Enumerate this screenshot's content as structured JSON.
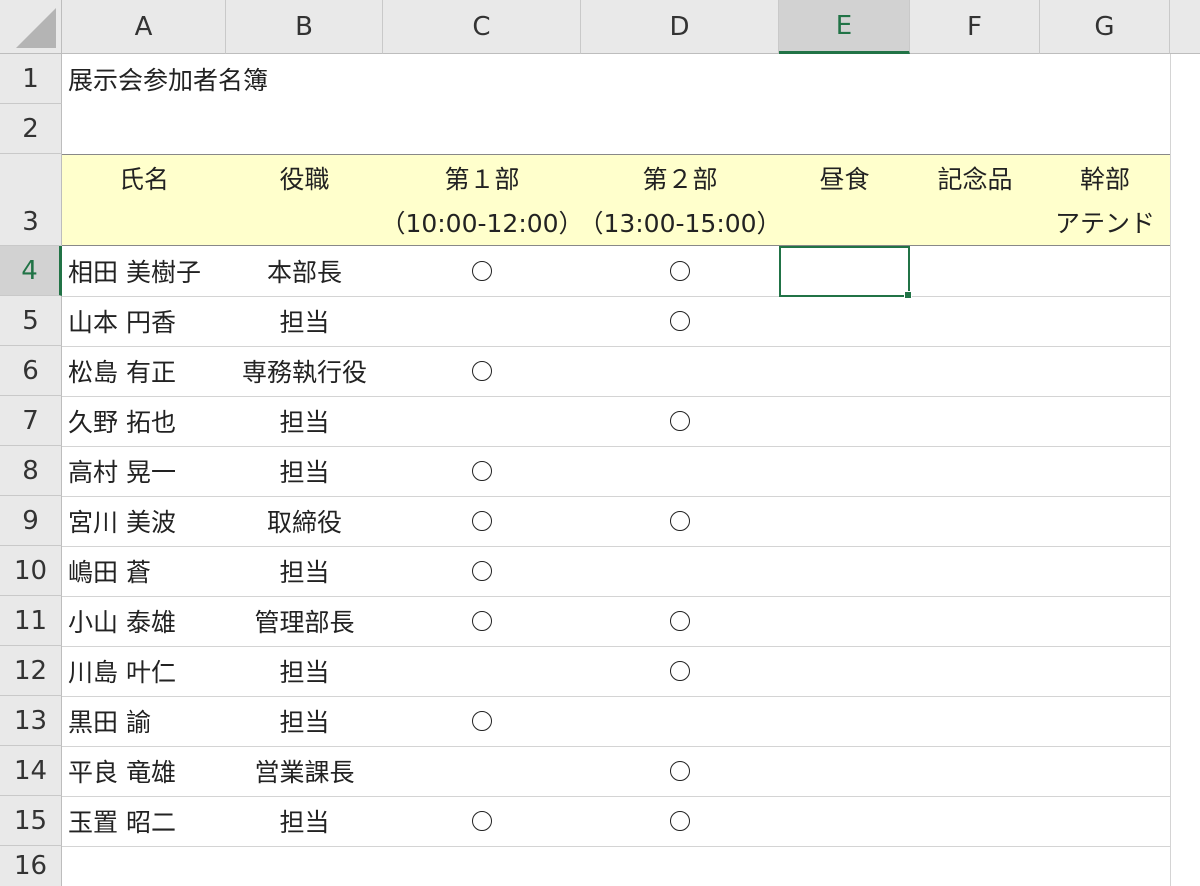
{
  "columns": [
    "A",
    "B",
    "C",
    "D",
    "E",
    "F",
    "G"
  ],
  "active_column": "E",
  "active_row": "4",
  "rows": [
    "1",
    "2",
    "3",
    "4",
    "5",
    "6",
    "7",
    "8",
    "9",
    "10",
    "11",
    "12",
    "13",
    "14",
    "15",
    "16"
  ],
  "title": "展示会参加者名簿",
  "headers": {
    "name": "氏名",
    "position": "役職",
    "session1_line1": "第１部",
    "session1_line2": "（10:00-12:00）",
    "session2_line1": "第２部",
    "session2_line2": "（13:00-15:00）",
    "lunch": "昼食",
    "gift": "記念品",
    "exec_line1": "幹部",
    "exec_line2": "アテンド"
  },
  "attendees": [
    {
      "name": "相田 美樹子",
      "position": "本部長",
      "s1": true,
      "s2": true
    },
    {
      "name": "山本 円香",
      "position": "担当",
      "s1": false,
      "s2": true
    },
    {
      "name": "松島 有正",
      "position": "専務執行役",
      "s1": true,
      "s2": false
    },
    {
      "name": "久野 拓也",
      "position": "担当",
      "s1": false,
      "s2": true
    },
    {
      "name": "高村 晃一",
      "position": "担当",
      "s1": true,
      "s2": false
    },
    {
      "name": "宮川 美波",
      "position": "取締役",
      "s1": true,
      "s2": true
    },
    {
      "name": "嶋田 蒼",
      "position": "担当",
      "s1": true,
      "s2": false
    },
    {
      "name": "小山 泰雄",
      "position": "管理部長",
      "s1": true,
      "s2": true
    },
    {
      "name": "川島 叶仁",
      "position": "担当",
      "s1": false,
      "s2": true
    },
    {
      "name": "黒田 諭",
      "position": "担当",
      "s1": true,
      "s2": false
    },
    {
      "name": "平良 竜雄",
      "position": "営業課長",
      "s1": false,
      "s2": true
    },
    {
      "name": "玉置 昭二",
      "position": "担当",
      "s1": true,
      "s2": true
    }
  ],
  "colors": {
    "header_fill": "#ffffcc",
    "selection": "#217346"
  }
}
